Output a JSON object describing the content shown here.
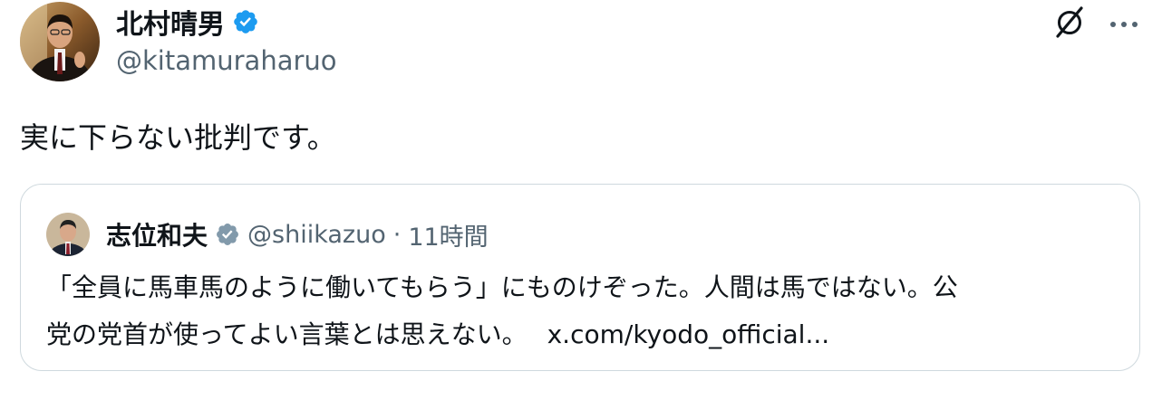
{
  "tweet": {
    "author": {
      "name": "北村晴男",
      "handle": "@kitamuraharuo",
      "verified_color": "#1d9bf0"
    },
    "text": "実に下らない批判です。",
    "icons": {
      "grok": "grok-icon",
      "more": "more-icon"
    }
  },
  "quote": {
    "author": {
      "name": "志位和夫",
      "handle": "@shiikazuo",
      "separator": "·",
      "time": "11時間",
      "verified_color": "#829aab"
    },
    "text_line1": "「全員に馬車馬のように働いてもらう」にものけぞった。人間は馬ではない。公",
    "text_line2": "党の党首が使ってよい言葉とは思えない。",
    "link": "x.com/kyodo_official..."
  },
  "colors": {
    "text_primary": "#0f1419",
    "text_secondary": "#536471",
    "border": "#cfd9de"
  }
}
